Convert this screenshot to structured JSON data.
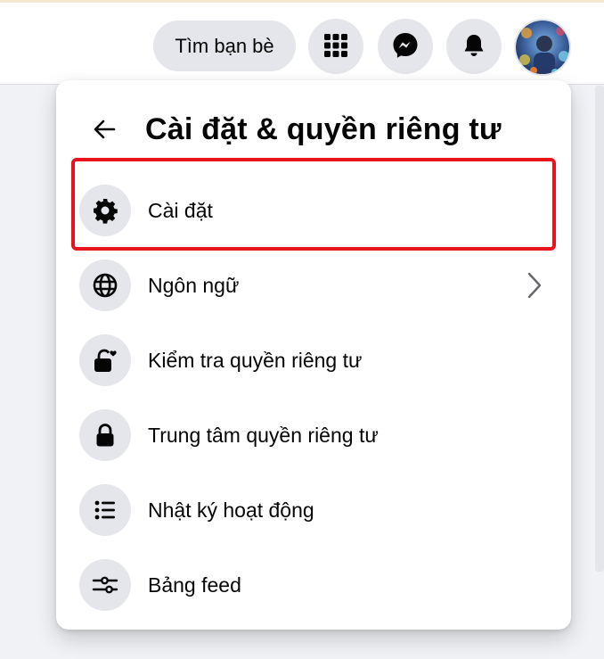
{
  "topbar": {
    "find_friends_label": "Tìm bạn bè",
    "icons": {
      "menu": "grid-menu-icon",
      "messenger": "messenger-icon",
      "notifications": "bell-icon",
      "account": "avatar"
    }
  },
  "panel": {
    "title": "Cài đặt & quyền riêng tư",
    "back_icon": "arrow-left-icon",
    "items": [
      {
        "label": "Cài đặt",
        "icon": "gear-icon",
        "highlighted": true
      },
      {
        "label": "Ngôn ngữ",
        "icon": "globe-icon",
        "has_chevron": true
      },
      {
        "label": "Kiểm tra quyền riêng tư",
        "icon": "lock-heart-icon"
      },
      {
        "label": "Trung tâm quyền riêng tư",
        "icon": "lock-icon"
      },
      {
        "label": "Nhật ký hoạt động",
        "icon": "list-icon"
      },
      {
        "label": "Bảng feed",
        "icon": "sliders-icon"
      }
    ]
  },
  "colors": {
    "highlight_border": "#e8141c",
    "icon_background": "#e4e6eb",
    "text": "#050505"
  }
}
